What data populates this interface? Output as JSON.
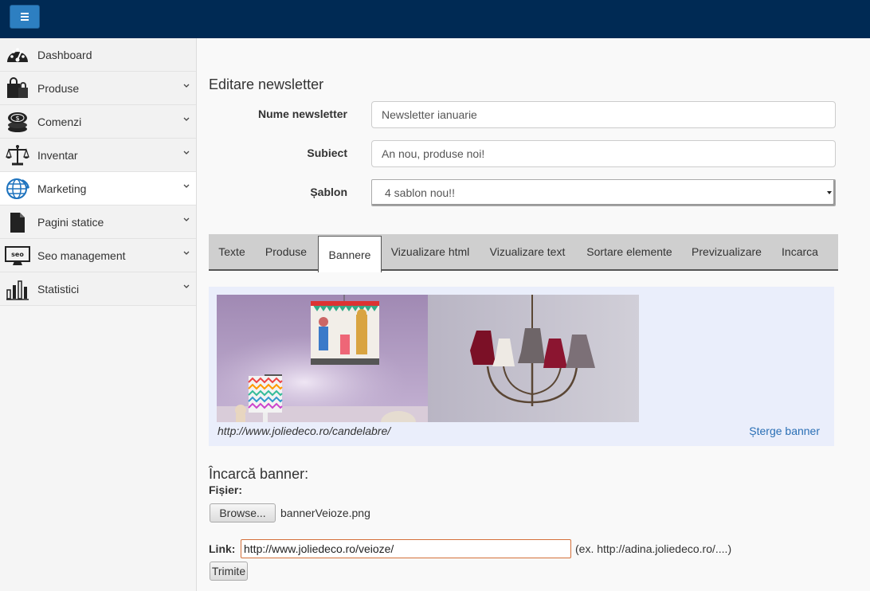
{
  "header": {
    "menu_icon": "hamburger-icon"
  },
  "sidebar": {
    "items": [
      {
        "label": "Dashboard",
        "icon": "dashboard-gauge-icon",
        "has_chevron": false
      },
      {
        "label": "Produse",
        "icon": "shopping-bags-icon",
        "has_chevron": true
      },
      {
        "label": "Comenzi",
        "icon": "coins-icon",
        "has_chevron": true
      },
      {
        "label": "Inventar",
        "icon": "balance-scale-icon",
        "has_chevron": true
      },
      {
        "label": "Marketing",
        "icon": "globe-icon",
        "has_chevron": true,
        "active": true
      },
      {
        "label": "Pagini statice",
        "icon": "document-icon",
        "has_chevron": true
      },
      {
        "label": "Seo management",
        "icon": "seo-monitor-icon",
        "has_chevron": true
      },
      {
        "label": "Statistici",
        "icon": "bar-chart-icon",
        "has_chevron": true
      }
    ]
  },
  "main": {
    "title": "Editare newsletter",
    "form": {
      "name_label": "Nume newsletter",
      "name_value": "Newsletter ianuarie",
      "subject_label": "Subiect",
      "subject_value": "An nou, produse noi!",
      "template_label": "Șablon",
      "template_value": "4 sablon nou!!"
    },
    "tabs": [
      {
        "label": "Texte"
      },
      {
        "label": "Produse"
      },
      {
        "label": "Bannere",
        "active": true
      },
      {
        "label": "Vizualizare html"
      },
      {
        "label": "Vizualizare text"
      },
      {
        "label": "Sortare elemente"
      },
      {
        "label": "Previzualizare"
      },
      {
        "label": "Incarca"
      }
    ],
    "banner": {
      "link": "http://www.joliedeco.ro/candelabre/",
      "delete_label": "Șterge banner"
    },
    "upload": {
      "title": "Încarcă banner:",
      "file_label": "Fișier:",
      "browse_label": "Browse...",
      "file_name": "bannerVeioze.png",
      "link_label": "Link:",
      "link_value": "http://www.joliedeco.ro/veioze/",
      "link_hint": "(ex. http://adina.joliedeco.ro/....)",
      "submit_label": "Trimite"
    }
  },
  "colors": {
    "topbar": "#002a54",
    "menu_button": "#2d7fc1",
    "link": "#2a6fb5",
    "banner_bg": "#eaeefb",
    "tab_bar": "#cfcfcf"
  }
}
